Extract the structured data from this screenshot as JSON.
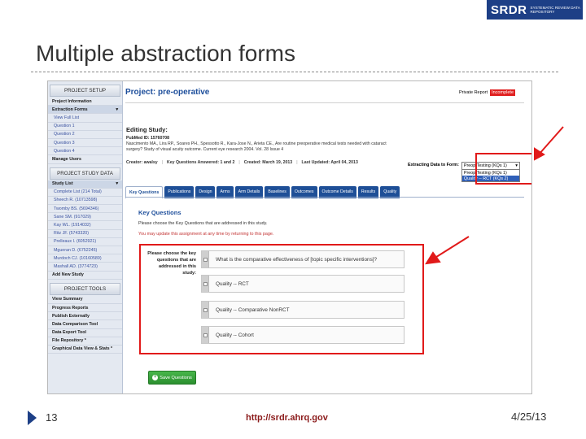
{
  "brand": {
    "logo_text": "SRDR",
    "logo_sub": "Systematic Review Data Repository"
  },
  "slide": {
    "title": "Multiple abstraction forms",
    "number": "13",
    "url": "http://srdr.ahrq.gov",
    "date": "4/25/13"
  },
  "sidebar": {
    "project_setup_heading": "PROJECT SETUP",
    "setup_items": [
      {
        "label": "Project Information"
      },
      {
        "label": "Extraction Forms"
      },
      {
        "label": "View Full List"
      },
      {
        "label": "Question 1"
      },
      {
        "label": "Question 2"
      },
      {
        "label": "Question 3"
      },
      {
        "label": "Question 4"
      },
      {
        "label": "Manage Users"
      }
    ],
    "study_data_heading": "PROJECT STUDY DATA",
    "study_list_label": "Study List",
    "study_items": [
      {
        "label": "Complete List (214 Total)"
      },
      {
        "label": "Sheech R. (10713598)"
      },
      {
        "label": "Twomby BS. (5694346)"
      },
      {
        "label": "Sane SM. (917029)"
      },
      {
        "label": "Kay WL. (1914032)"
      },
      {
        "label": "Ritz JF. (5743320)"
      },
      {
        "label": "Prelleaux I. (6052921)"
      },
      {
        "label": "Mgueran D. (6752245)"
      },
      {
        "label": "Murdoch CJ. (10160589)"
      },
      {
        "label": "Mashall AD. (3774723)"
      },
      {
        "label": "Add New Study"
      }
    ],
    "tools_heading": "PROJECT TOOLS",
    "tool_items": [
      {
        "label": "View Summary"
      },
      {
        "label": "Progress Reports"
      },
      {
        "label": "Publish Externally"
      },
      {
        "label": "Data Comparison Tool"
      },
      {
        "label": "Data Export Tool"
      },
      {
        "label": "File Repository *"
      },
      {
        "label": "Graphical Data View & Stats *"
      }
    ]
  },
  "main": {
    "project_title": "Project: pre-operative",
    "private_report_label": "Private Report",
    "status_badge": "Incomplete",
    "editing_label": "Editing Study:",
    "pubmed_id": "PubMed ID: 15760708",
    "citation": "Nascimento MA., Lira RP., Soares PH., Spessotto R., Kara-Jose N., Arieta CE., Are routine preoperative medical tests needed with cataract surgery? Study of visual acuity outcome. Current eye research 2004. Vol. 28 Issue 4",
    "meta": {
      "creator": "Creator: awalsy",
      "kq_answered": "Key Questions Answered: 1 and 2",
      "created": "Created: March 19, 2013",
      "updated": "Last Updated: April 04, 2013"
    },
    "extract": {
      "label": "Extracting Data to Form:",
      "selected": "Preop Testing (KQs 1)",
      "options": [
        "Preop Testing (KQs 1)",
        "Quality -- RCT (KQs 2)"
      ],
      "highlighted_index": 1
    },
    "tabs": [
      "Key Questions",
      "Publications",
      "Design",
      "Arms",
      "Arm Details",
      "Baselines",
      "Outcomes",
      "Outcome Details",
      "Results",
      "Quality"
    ],
    "active_tab": "Key Questions",
    "key_questions": {
      "heading": "Key Questions",
      "description": "Please choose the Key Questions that are addressed in this study.",
      "note": "You may update this assignment at any time by returning to this page.",
      "choose_label": "Please choose the key questions that are addressed in this study:",
      "questions": [
        "What is the comparative effectiveness of [topic specific interventions]?",
        "Quality -- RCT",
        "Quality -- Comparative NonRCT",
        "Quality -- Cohort"
      ]
    },
    "save_label": "Save Questions"
  },
  "colors": {
    "brand_blue": "#1d3f86",
    "tab_blue": "#1e4f97",
    "callout_red": "#e11a1a",
    "save_green": "#2b8f2f",
    "link_blue": "#1d4e9b"
  }
}
